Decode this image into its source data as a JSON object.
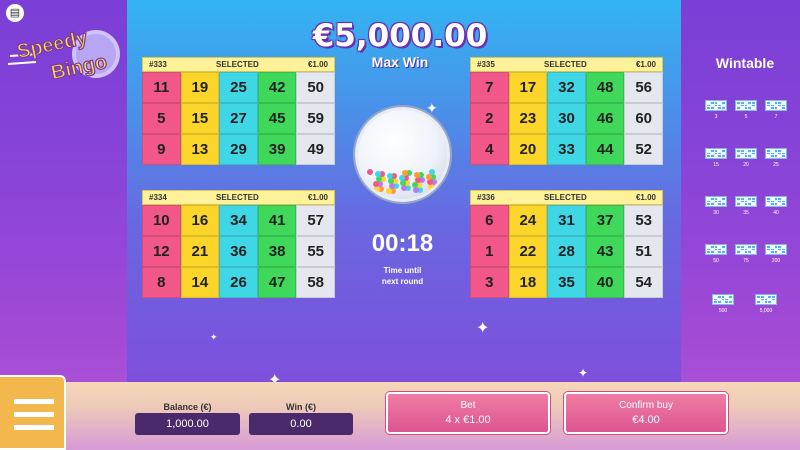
{
  "header": {
    "jackpot": "€5,000.00",
    "max_win_label": "Max Win"
  },
  "logo": {
    "line1": "Speedy",
    "line2": "Bingo"
  },
  "cards": [
    {
      "id": "#333",
      "status": "SELECTED",
      "price": "€1.00",
      "rows": [
        [
          11,
          19,
          25,
          42,
          50
        ],
        [
          5,
          15,
          27,
          45,
          59
        ],
        [
          9,
          13,
          29,
          39,
          49
        ]
      ]
    },
    {
      "id": "#335",
      "status": "SELECTED",
      "price": "€1.00",
      "rows": [
        [
          7,
          17,
          32,
          48,
          56
        ],
        [
          2,
          23,
          30,
          46,
          60
        ],
        [
          4,
          20,
          33,
          44,
          52
        ]
      ]
    },
    {
      "id": "#334",
      "status": "SELECTED",
      "price": "€1.00",
      "rows": [
        [
          10,
          16,
          34,
          41,
          57
        ],
        [
          12,
          21,
          36,
          38,
          55
        ],
        [
          8,
          14,
          26,
          47,
          58
        ]
      ]
    },
    {
      "id": "#336",
      "status": "SELECTED",
      "price": "€1.00",
      "rows": [
        [
          6,
          24,
          31,
          37,
          53
        ],
        [
          1,
          22,
          28,
          43,
          51
        ],
        [
          3,
          18,
          35,
          40,
          54
        ]
      ]
    }
  ],
  "timer": {
    "value": "00:18",
    "caption_line1": "Time until",
    "caption_line2": "next round"
  },
  "wintable": {
    "title": "Wintable",
    "items": [
      "3",
      "5",
      "7",
      "15",
      "20",
      "25",
      "30",
      "35",
      "40",
      "50",
      "75",
      "200",
      "500",
      "5,000"
    ]
  },
  "footer": {
    "balance_label": "Balance (€)",
    "balance_value": "1,000.00",
    "win_label": "Win (€)",
    "win_value": "0.00",
    "bet_label": "Bet",
    "bet_value": "4 x €1.00",
    "confirm_label": "Confirm buy",
    "confirm_value": "€4.00"
  },
  "colors": {
    "pink": "#f2578a",
    "yellow": "#fbd52a",
    "cyan": "#3fd6e6",
    "green": "#3fd85a",
    "white": "#e4e8ee"
  },
  "icons": {
    "info": "document-icon",
    "menu": "hamburger-icon"
  }
}
